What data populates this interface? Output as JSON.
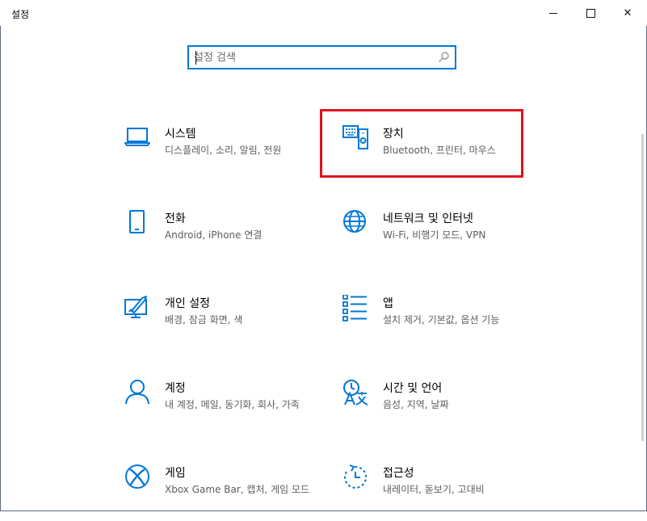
{
  "window": {
    "title": "설정",
    "minimize_glyph": "minimize-icon",
    "maximize_glyph": "maximize-icon",
    "close_glyph": "✕"
  },
  "search": {
    "placeholder": "설정 검색",
    "value": ""
  },
  "tiles": [
    {
      "name": "시스템",
      "desc": "디스플레이, 소리, 알림, 전원",
      "icon": "laptop-icon"
    },
    {
      "name": "장치",
      "desc": "Bluetooth, 프린터, 마우스",
      "icon": "devices-icon"
    },
    {
      "name": "전화",
      "desc": "Android, iPhone 연결",
      "icon": "phone-icon"
    },
    {
      "name": "네트워크 및 인터넷",
      "desc": "Wi-Fi, 비행기 모드, VPN",
      "icon": "globe-icon"
    },
    {
      "name": "개인 설정",
      "desc": "배경, 잠금 화면, 색",
      "icon": "personalization-icon"
    },
    {
      "name": "앱",
      "desc": "설치 제거, 기본값, 옵션 기능",
      "icon": "apps-list-icon"
    },
    {
      "name": "계정",
      "desc": "내 계정, 메일, 동기화, 회사, 가족",
      "icon": "account-icon"
    },
    {
      "name": "시간 및 언어",
      "desc": "음성, 지역, 날짜",
      "icon": "time-language-icon"
    },
    {
      "name": "게임",
      "desc": "Xbox Game Bar, 캡처, 게임 모드",
      "icon": "xbox-icon"
    },
    {
      "name": "접근성",
      "desc": "내레이터, 돋보기, 고대비",
      "icon": "ease-of-access-icon"
    }
  ],
  "colors": {
    "accent": "#0078d7",
    "highlight": "#e0101e",
    "secondary_text": "#5d5d5d"
  }
}
